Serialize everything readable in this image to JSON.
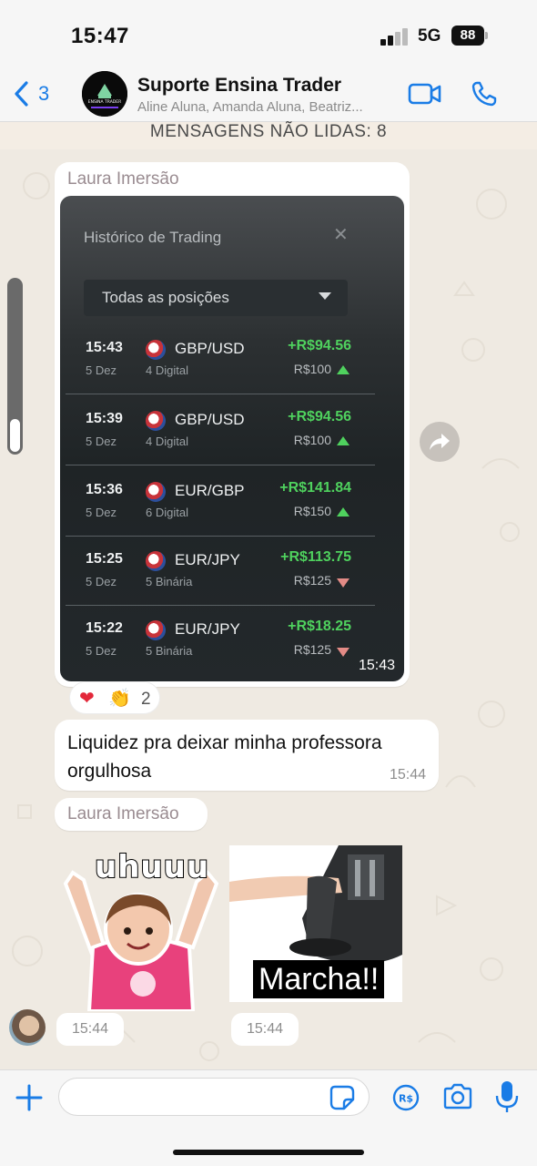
{
  "status_bar": {
    "time": "15:47",
    "network": "5G",
    "battery": "88"
  },
  "header": {
    "back_count": "3",
    "title": "Suporte Ensina Trader",
    "members": "Aline Aluna, Amanda Aluna, Beatriz...",
    "avatar_logo_text": "ENSINA TRADER"
  },
  "unread_banner": "MENSAGENS NÃO LIDAS: 8",
  "messages": {
    "image_msg": {
      "sender": "Laura Imersão",
      "time": "15:43",
      "screenshot": {
        "title": "Histórico de Trading",
        "filter": "Todas as posições",
        "trades": [
          {
            "time": "15:43",
            "date": "5 Dez",
            "pair": "GBP/USD",
            "type": "4 Digital",
            "profit": "+R$94.56",
            "amount": "R$100",
            "direction": "up"
          },
          {
            "time": "15:39",
            "date": "5 Dez",
            "pair": "GBP/USD",
            "type": "4 Digital",
            "profit": "+R$94.56",
            "amount": "R$100",
            "direction": "up"
          },
          {
            "time": "15:36",
            "date": "5 Dez",
            "pair": "EUR/GBP",
            "type": "6 Digital",
            "profit": "+R$141.84",
            "amount": "R$150",
            "direction": "up"
          },
          {
            "time": "15:25",
            "date": "5 Dez",
            "pair": "EUR/JPY",
            "type": "5 Binária",
            "profit": "+R$113.75",
            "amount": "R$125",
            "direction": "down"
          },
          {
            "time": "15:22",
            "date": "5 Dez",
            "pair": "EUR/JPY",
            "type": "5 Binária",
            "profit": "+R$18.25",
            "amount": "R$125",
            "direction": "down"
          }
        ]
      },
      "reactions": {
        "heart": "❤",
        "clap": "👏",
        "count": "2"
      }
    },
    "text_msg": {
      "text": "Liquidez pra deixar minha professora orgulhosa",
      "time": "15:44"
    },
    "sticker_group": {
      "sender": "Laura Imersão",
      "sticker1_caption": "uhuuu",
      "sticker2_caption": "Marcha!!",
      "time1": "15:44",
      "time2": "15:44"
    }
  },
  "input": {
    "placeholder": "",
    "value": ""
  },
  "colors": {
    "accent": "#1a7ce6",
    "wallpaper": "#efeae2",
    "profit_green": "#4fd25e"
  }
}
